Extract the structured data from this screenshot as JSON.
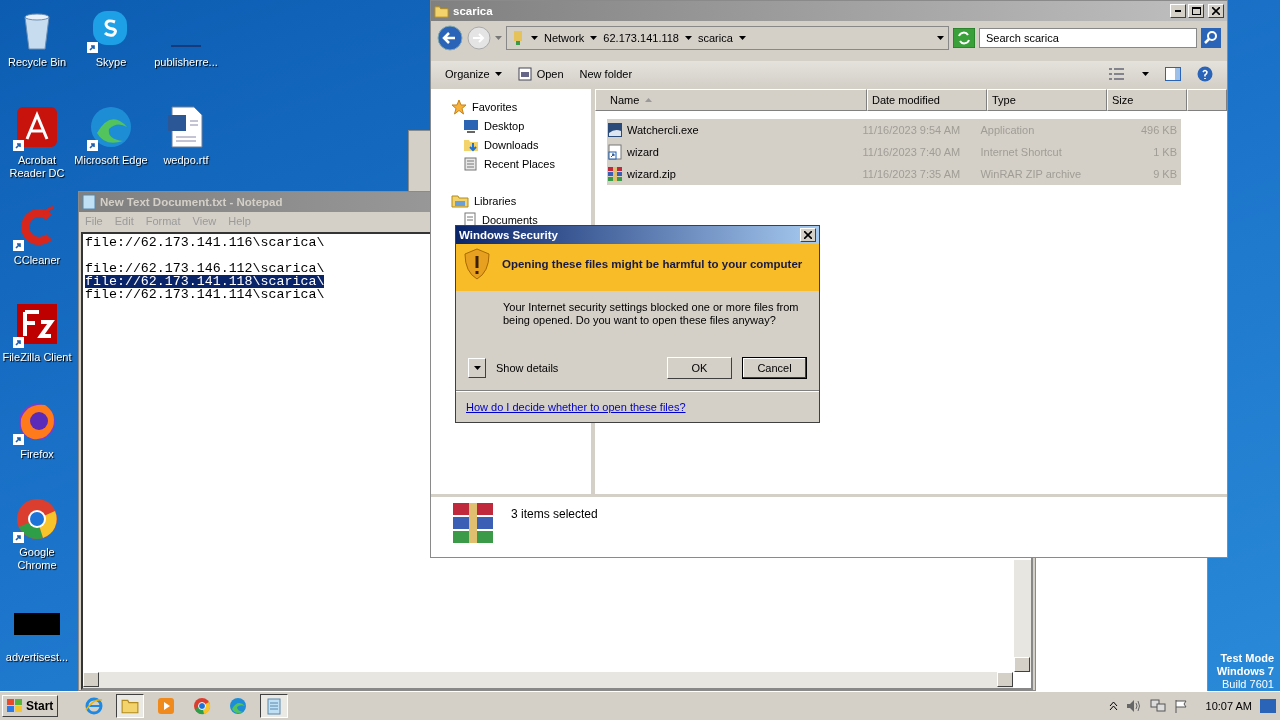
{
  "desktop": {
    "icons": [
      {
        "label": "Recycle Bin",
        "kind": "recycle",
        "shortcut": false
      },
      {
        "label": "Skype",
        "kind": "skype",
        "shortcut": true
      },
      {
        "label": "publisherre...",
        "kind": "blank",
        "shortcut": false
      },
      {
        "label": "Acrobat Reader DC",
        "kind": "acrobat",
        "shortcut": true
      },
      {
        "label": "Microsoft Edge",
        "kind": "edge",
        "shortcut": true
      },
      {
        "label": "wedpo.rtf",
        "kind": "word",
        "shortcut": false
      },
      {
        "label": "CCleaner",
        "kind": "ccleaner",
        "shortcut": true
      },
      {
        "label": "FileZilla Client",
        "kind": "filezilla",
        "shortcut": true
      },
      {
        "label": "Firefox",
        "kind": "firefox",
        "shortcut": true
      },
      {
        "label": "Google Chrome",
        "kind": "chrome",
        "shortcut": true
      },
      {
        "label": "advertisest...",
        "kind": "black",
        "shortcut": false
      }
    ],
    "os_notice": [
      "Test Mode",
      "Windows 7",
      "Build 7601"
    ]
  },
  "notepad": {
    "title": "New Text Document.txt - Notepad",
    "menu": [
      "File",
      "Edit",
      "Format",
      "View",
      "Help"
    ],
    "lines": [
      {
        "kind": "text",
        "text": "file://62.173.141.116\\scarica\\",
        "selected": false
      },
      {
        "kind": "blank"
      },
      {
        "kind": "text",
        "text": "file://62.173.146.112\\scarica\\",
        "selected": false
      },
      {
        "kind": "text",
        "text": "file://62.173.141.118\\scarica\\",
        "selected": true
      },
      {
        "kind": "text",
        "text": "file://62.173.141.114\\scarica\\",
        "selected": false
      }
    ]
  },
  "explorer": {
    "title": "scarica",
    "breadcrumb": [
      "Network",
      "62.173.141.118",
      "scarica"
    ],
    "search": {
      "placeholder": "Search scarica"
    },
    "toolbar": [
      {
        "label": "Organize",
        "kind": "menu"
      },
      {
        "label": "Open",
        "kind": "open"
      },
      {
        "label": "New folder",
        "kind": "plain"
      }
    ],
    "nav": [
      {
        "label": "Favorites",
        "kind": "star",
        "children": [
          {
            "label": "Desktop",
            "kind": "desktop"
          },
          {
            "label": "Downloads",
            "kind": "downloads"
          },
          {
            "label": "Recent Places",
            "kind": "recent"
          }
        ]
      },
      {
        "label": "Libraries",
        "kind": "library",
        "children": [
          {
            "label": "Documents",
            "kind": "documents"
          }
        ]
      }
    ],
    "columns": [
      {
        "label": "Name",
        "sorted": true
      },
      {
        "label": "Date modified",
        "sorted": false
      },
      {
        "label": "Type",
        "sorted": false
      },
      {
        "label": "Size",
        "sorted": false
      }
    ],
    "rows": [
      {
        "name": "Watchercli.exe",
        "date": "11/16/2023 9:54 AM",
        "type": "Application",
        "size": "496 KB",
        "kind": "exe",
        "selected": true
      },
      {
        "name": "wizard",
        "date": "11/16/2023 7:40 AM",
        "type": "Internet Shortcut",
        "size": "1 KB",
        "kind": "shortcut",
        "selected": true
      },
      {
        "name": "wizard.zip",
        "date": "11/16/2023 7:35 AM",
        "type": "WinRAR ZIP archive",
        "size": "9 KB",
        "kind": "zip",
        "selected": true
      }
    ],
    "status": "3 items selected"
  },
  "dialog": {
    "title": "Windows Security",
    "heading": "Opening these files might be harmful to your computer",
    "message": "Your Internet security settings blocked one or more files from being opened. Do you want to open these files anyway?",
    "details_toggle": "Show details",
    "buttons": [
      {
        "label": "OK",
        "default": false
      },
      {
        "label": "Cancel",
        "default": true
      }
    ],
    "link": "How do I decide whether to open these files?"
  },
  "taskbar": {
    "start": "Start",
    "apps": [
      {
        "kind": "ie",
        "active": false
      },
      {
        "kind": "explorer",
        "active": true
      },
      {
        "kind": "media",
        "active": false
      },
      {
        "kind": "chrome",
        "active": false
      },
      {
        "kind": "edge",
        "active": false
      },
      {
        "kind": "notepad",
        "active": true
      }
    ],
    "clock": "10:07 AM"
  }
}
